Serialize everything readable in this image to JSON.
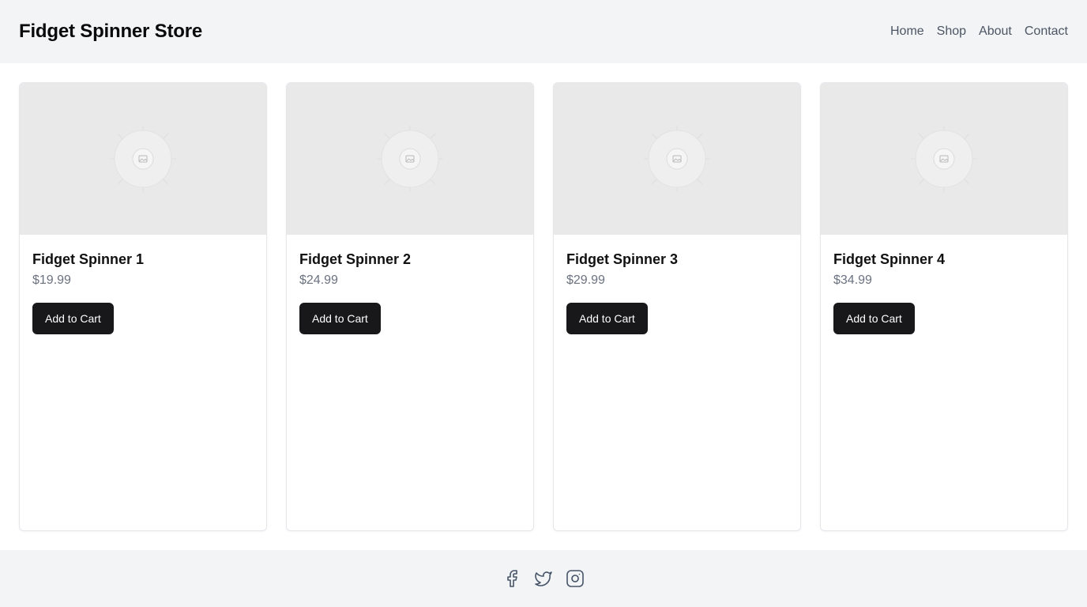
{
  "header": {
    "title": "Fidget Spinner Store",
    "nav": [
      "Home",
      "Shop",
      "About",
      "Contact"
    ]
  },
  "products": [
    {
      "name": "Fidget Spinner 1",
      "price": "$19.99",
      "button": "Add to Cart",
      "image_icon": "image-placeholder-icon"
    },
    {
      "name": "Fidget Spinner 2",
      "price": "$24.99",
      "button": "Add to Cart",
      "image_icon": "image-placeholder-icon"
    },
    {
      "name": "Fidget Spinner 3",
      "price": "$29.99",
      "button": "Add to Cart",
      "image_icon": "image-placeholder-icon"
    },
    {
      "name": "Fidget Spinner 4",
      "price": "$34.99",
      "button": "Add to Cart",
      "image_icon": "image-placeholder-icon"
    }
  ],
  "footer": {
    "social_icons": [
      "facebook-icon",
      "twitter-icon",
      "instagram-icon"
    ]
  },
  "colors": {
    "header_bg": "#f3f4f6",
    "button_bg": "#18181b",
    "price_text": "#6b7280",
    "image_bg": "#e9e9e9"
  }
}
